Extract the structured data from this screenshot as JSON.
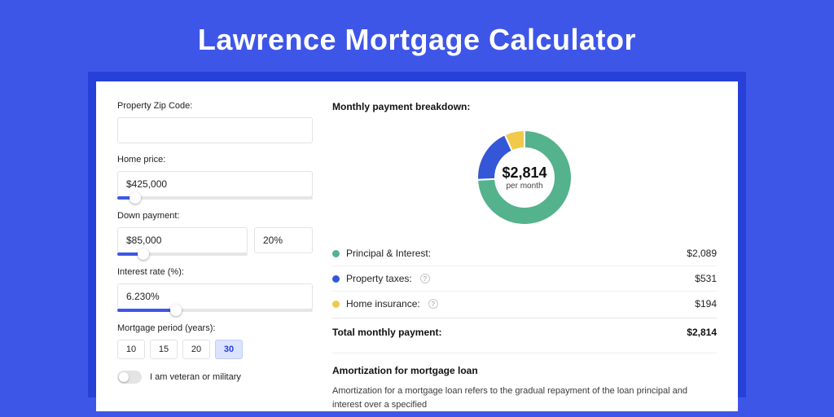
{
  "title": "Lawrence Mortgage Calculator",
  "inputs": {
    "zip_label": "Property Zip Code:",
    "zip_value": "",
    "home_price_label": "Home price:",
    "home_price_value": "$425,000",
    "home_price_slider_pct": 9,
    "down_payment_label": "Down payment:",
    "down_payment_value": "$85,000",
    "down_payment_pct": "20%",
    "down_payment_slider_pct": 20,
    "interest_label": "Interest rate (%):",
    "interest_value": "6.230%",
    "interest_slider_pct": 30,
    "period_label": "Mortgage period (years):",
    "period_options": [
      "10",
      "15",
      "20",
      "30"
    ],
    "period_selected": "30",
    "veteran_label": "I am veteran or military",
    "veteran_on": false
  },
  "breakdown": {
    "heading": "Monthly payment breakdown:",
    "center_amount": "$2,814",
    "center_sub": "per month",
    "rows": [
      {
        "label": "Principal & Interest:",
        "value": "$2,089",
        "color": "#54b28c",
        "info": false
      },
      {
        "label": "Property taxes:",
        "value": "$531",
        "color": "#3357d6",
        "info": true
      },
      {
        "label": "Home insurance:",
        "value": "$194",
        "color": "#f1c94b",
        "info": true
      }
    ],
    "total_label": "Total monthly payment:",
    "total_value": "$2,814"
  },
  "amortization": {
    "title": "Amortization for mortgage loan",
    "text": "Amortization for a mortgage loan refers to the gradual repayment of the loan principal and interest over a specified"
  },
  "chart_data": {
    "type": "pie",
    "title": "Monthly payment breakdown",
    "categories": [
      "Principal & Interest",
      "Property taxes",
      "Home insurance"
    ],
    "values": [
      2089,
      531,
      194
    ],
    "colors": [
      "#54b28c",
      "#3357d6",
      "#f1c94b"
    ],
    "total": 2814,
    "inner_radius_ratio": 0.62,
    "center_label": "$2,814 per month"
  }
}
